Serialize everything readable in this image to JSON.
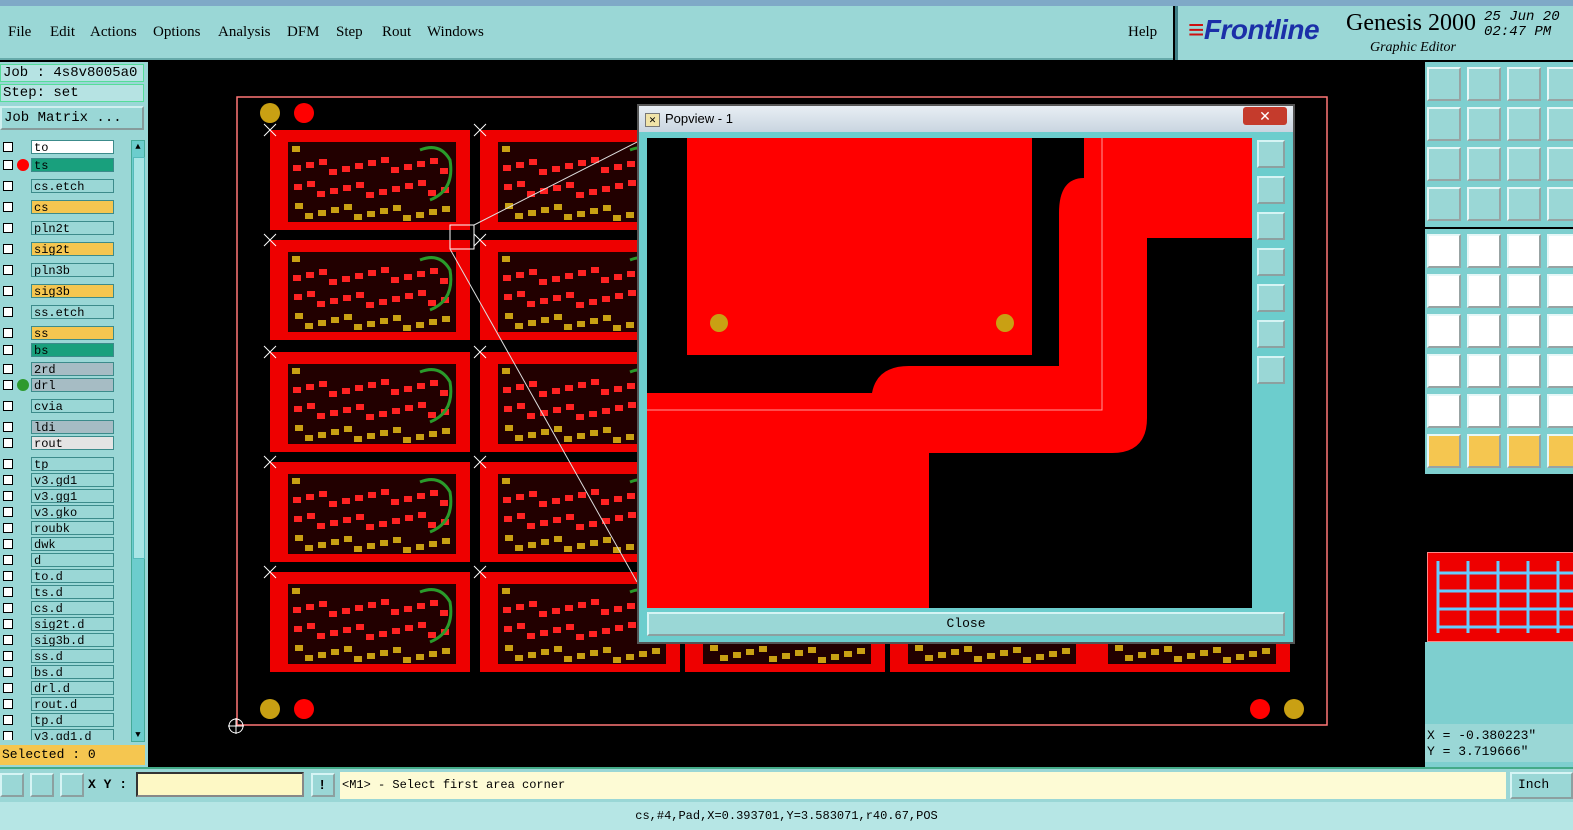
{
  "menu": {
    "items": [
      "File",
      "Edit",
      "Actions",
      "Options",
      "Analysis",
      "DFM",
      "Step",
      "Rout",
      "Windows"
    ],
    "help": "Help"
  },
  "brand": {
    "logo": "Frontline",
    "product": "Genesis 2000",
    "subtitle": "Graphic Editor",
    "date": "25 Jun 20",
    "time": "02:47 PM"
  },
  "job": {
    "job_label": "Job : 4s8v8005a0",
    "step_label": "Step: set",
    "matrix_button": "Job Matrix ..."
  },
  "layers": [
    {
      "name": "to",
      "color": "#ffffff",
      "dot": ""
    },
    {
      "name": "ts",
      "color": "#19a07d",
      "dot": "#ff0000"
    },
    {
      "name": "cs.etch",
      "color": "#9ad7d6",
      "dot": ""
    },
    {
      "name": "cs",
      "color": "#f5c650",
      "dot": ""
    },
    {
      "name": "pln2t",
      "color": "#9ad7d6",
      "dot": ""
    },
    {
      "name": "sig2t",
      "color": "#f5c650",
      "dot": ""
    },
    {
      "name": "pln3b",
      "color": "#9ad7d6",
      "dot": ""
    },
    {
      "name": "sig3b",
      "color": "#f5c650",
      "dot": ""
    },
    {
      "name": "ss.etch",
      "color": "#9ad7d6",
      "dot": ""
    },
    {
      "name": "ss",
      "color": "#f5c650",
      "dot": ""
    },
    {
      "name": "bs",
      "color": "#19a07d",
      "dot": ""
    },
    {
      "name": "2rd",
      "color": "#a6bcc4",
      "dot": ""
    },
    {
      "name": "drl",
      "color": "#a6bcc4",
      "dot": "#2e9a2e"
    },
    {
      "name": "cvia",
      "color": "#9ad7d6",
      "dot": ""
    },
    {
      "name": "ldi",
      "color": "#a6bcc4",
      "dot": ""
    },
    {
      "name": "rout",
      "color": "#e4e4e4",
      "dot": ""
    },
    {
      "name": "tp",
      "color": "#9ad7d6",
      "dot": ""
    },
    {
      "name": "v3.gd1",
      "color": "#9ad7d6",
      "dot": ""
    },
    {
      "name": "v3.gg1",
      "color": "#9ad7d6",
      "dot": ""
    },
    {
      "name": "v3.gko",
      "color": "#9ad7d6",
      "dot": ""
    },
    {
      "name": "roubk",
      "color": "#9ad7d6",
      "dot": ""
    },
    {
      "name": "dwk",
      "color": "#9ad7d6",
      "dot": ""
    },
    {
      "name": "d",
      "color": "#9ad7d6",
      "dot": ""
    },
    {
      "name": "to.d",
      "color": "#9ad7d6",
      "dot": ""
    },
    {
      "name": "ts.d",
      "color": "#9ad7d6",
      "dot": ""
    },
    {
      "name": "cs.d",
      "color": "#9ad7d6",
      "dot": ""
    },
    {
      "name": "sig2t.d",
      "color": "#9ad7d6",
      "dot": ""
    },
    {
      "name": "sig3b.d",
      "color": "#9ad7d6",
      "dot": ""
    },
    {
      "name": "ss.d",
      "color": "#9ad7d6",
      "dot": ""
    },
    {
      "name": "bs.d",
      "color": "#9ad7d6",
      "dot": ""
    },
    {
      "name": "drl.d",
      "color": "#9ad7d6",
      "dot": ""
    },
    {
      "name": "rout.d",
      "color": "#9ad7d6",
      "dot": ""
    },
    {
      "name": "tp.d",
      "color": "#9ad7d6",
      "dot": ""
    },
    {
      "name": "v3.gd1.d",
      "color": "#9ad7d6",
      "dot": ""
    }
  ],
  "selected": "Selected : 0",
  "popview": {
    "title": "Popview - 1",
    "close_button": "Close",
    "close_x": "✕"
  },
  "coords": {
    "x": "X = -0.380223\"",
    "y": "Y = 3.719666\""
  },
  "status": {
    "xy_label": "X Y :",
    "xy_value": "",
    "message": "<M1> - Select first area corner",
    "unit": "Inch",
    "feature_info": "cs,#4,Pad,X=0.393701,Y=3.583071,r40.67,POS"
  },
  "colors": {
    "panel": "#9ad7d6",
    "copper": "#ff0000",
    "highlight_yellow": "#f5c650",
    "brand_blue": "#1b2fa8"
  }
}
